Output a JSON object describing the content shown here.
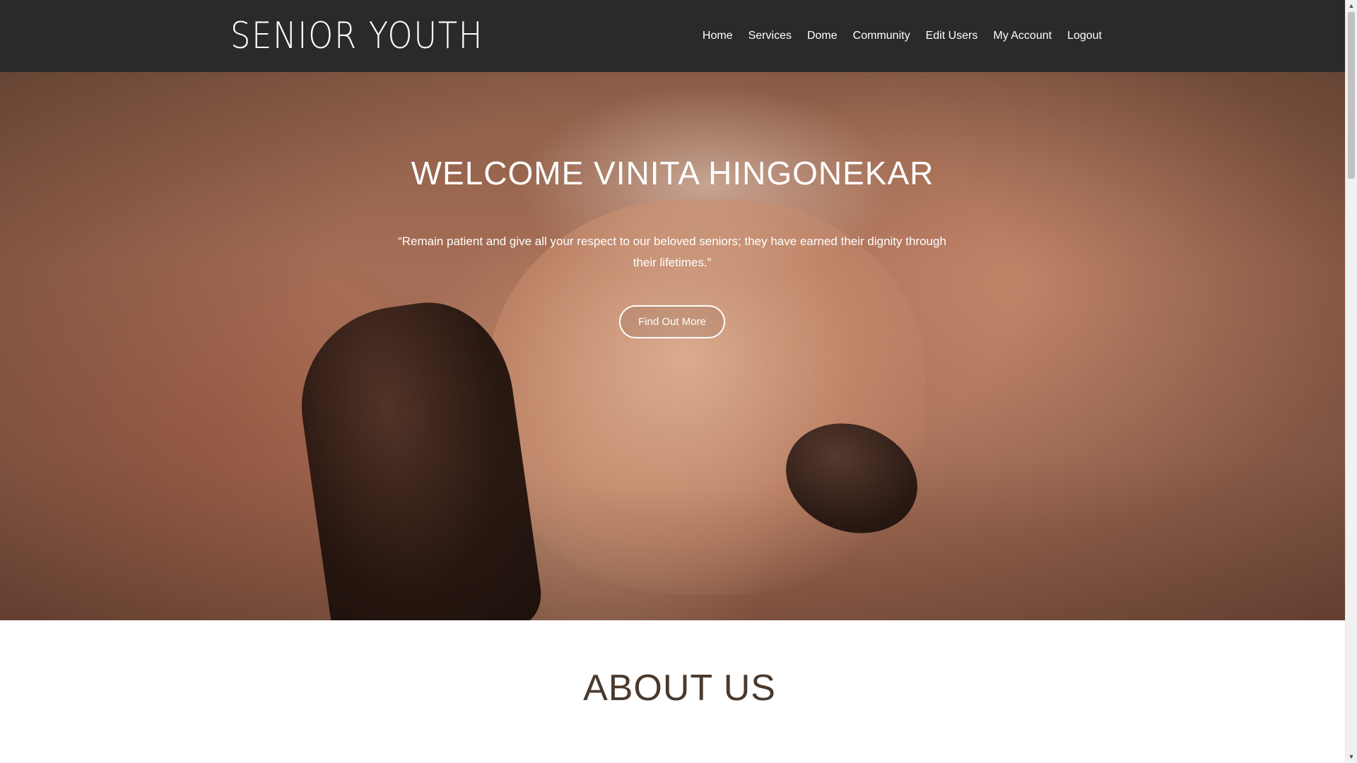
{
  "header": {
    "brand": "SENIOR YOUTH",
    "nav": [
      {
        "label": "Home"
      },
      {
        "label": "Services"
      },
      {
        "label": "Dome"
      },
      {
        "label": "Community"
      },
      {
        "label": "Edit Users"
      },
      {
        "label": "My Account"
      },
      {
        "label": "Logout"
      }
    ]
  },
  "hero": {
    "title": "WELCOME VINITA HINGONEKAR",
    "quote": "“Remain patient and give all your respect to our beloved seniors; they have earned their dignity through their lifetimes.”",
    "button_label": "Find Out More",
    "image_icon": "elderly-hands-on-cane-photo"
  },
  "about": {
    "title": "ABOUT US"
  },
  "scrollbar": {
    "up_icon": "▲",
    "down_icon": "▼"
  },
  "colors": {
    "navbar_bg": "#2a2a2c",
    "heading_brown": "#4a3a2e",
    "text_white": "#ffffff"
  }
}
